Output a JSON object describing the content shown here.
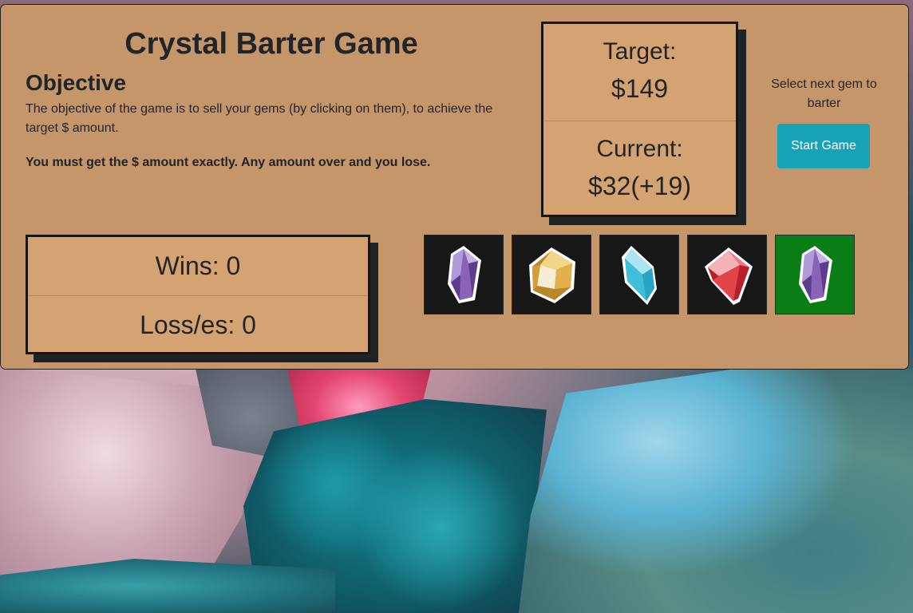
{
  "game": {
    "title": "Crystal Barter Game",
    "objective_heading": "Objective",
    "objective_text": "The objective of the game is to sell your gems (by clicking on them), to achieve the target $ amount.",
    "objective_rule": "You must get the $ amount exactly. Any amount over and you lose."
  },
  "score": {
    "target_label": "Target:",
    "target_value": "$149",
    "current_label": "Current:",
    "current_value": "$32(+19)"
  },
  "stats": {
    "wins": "Wins: 0",
    "losses": "Loss/es: 0"
  },
  "controls": {
    "select_text": "Select next gem to barter",
    "start_label": "Start Game"
  },
  "gems": [
    {
      "icon": "purple-crystal-icon",
      "color": "#8a63b8",
      "selected": false
    },
    {
      "icon": "yellow-gem-icon",
      "color": "#e2b04c",
      "selected": false
    },
    {
      "icon": "blue-crystal-icon",
      "color": "#3fbfdc",
      "selected": false
    },
    {
      "icon": "red-gem-icon",
      "color": "#e2444a",
      "selected": false
    },
    {
      "icon": "purple-crystal-icon",
      "color": "#8a63b8",
      "selected": true
    }
  ],
  "colors": {
    "panel": "#c59669",
    "card": "#d5a372",
    "button": "#17a2b8",
    "selected_gem_bg": "#0a7d16"
  }
}
